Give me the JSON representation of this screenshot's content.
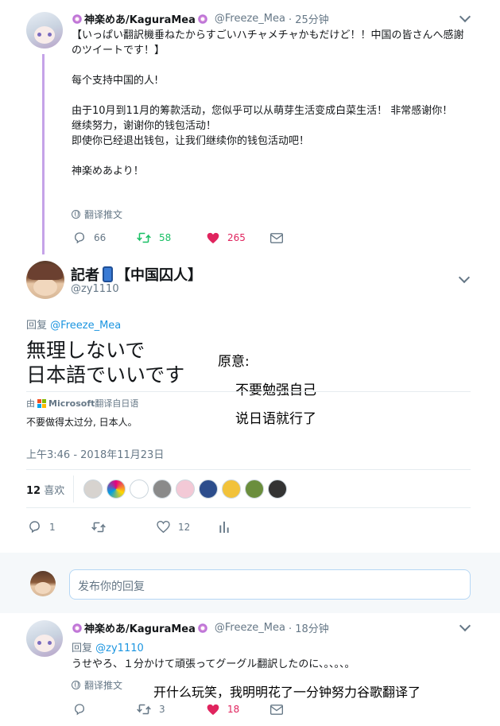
{
  "tweet1": {
    "display_name": "神楽めあ/KaguraMea",
    "handle": "@Freeze_Mea",
    "time": "· 25分钟",
    "text": "【いっぱい翻訳機垂ねたからすごいハチャメチャかもだけど！！中国の皆さんへ感謝のツイートです！】\n\n每个支持中国的人!\n\n由于10月到11月的筹款活动，您似乎可以从萌芽生活变成白菜生活！ 非常感谢你！\n继续努力，谢谢你的钱包活动！\n即使你已经退出钱包，让我们继续你的钱包活动吧！\n\n神楽めあより！",
    "translate_label": "翻译推文",
    "replies": "66",
    "retweets": "58",
    "likes": "265"
  },
  "tweet2": {
    "display_name": "記者",
    "display_name_suffix": "【中国囚人】",
    "handle": "@zy1110",
    "reply_prefix": "回复",
    "reply_to": "@Freeze_Mea",
    "main_text_line1": "無理しないで",
    "main_text_line2": "日本語でいいです",
    "translated_by_prefix": "由",
    "translated_by_brand": "Microsoft",
    "translated_by_suffix": "翻译自日语",
    "translation": "不要做得太过分, 日本人。",
    "timestamp": "上午3:46 - 2018年11月23日",
    "likes_count": "12",
    "likes_label": "喜欢",
    "replies": "1",
    "likes": "12"
  },
  "overlay": {
    "label": "原意:",
    "line1": "不要勉强自己",
    "line2": "说日语就行了",
    "bottom": "开什么玩笑，我明明花了一分钟努力谷歌翻译了"
  },
  "reply_box": {
    "placeholder": "发布你的回复"
  },
  "tweet3": {
    "display_name": "神楽めあ/KaguraMea",
    "handle": "@Freeze_Mea",
    "time": "· 18分钟",
    "reply_prefix": "回复",
    "reply_to": "@zy1110",
    "text": "うせやろ、１分かけて頑張ってグーグル翻訳したのに、。、。、。",
    "translate_label": "翻译推文",
    "retweets": "3",
    "likes": "18"
  },
  "colors": {
    "link": "#1da1f2",
    "retweet_green": "#17bf63",
    "like_red": "#e0245e",
    "gray_text": "#657786",
    "thread_line": "#c5a3e8"
  }
}
